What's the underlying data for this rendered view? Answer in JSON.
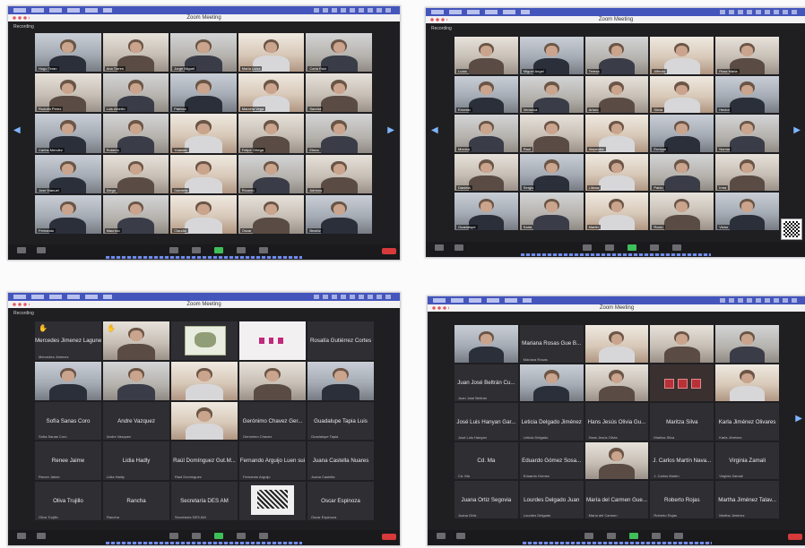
{
  "meeting_title": "Zoom Meeting",
  "sub_label": "Recording",
  "windows": [
    {
      "id": "w1",
      "tiles": [
        {
          "kind": "vid",
          "tone": "c",
          "name": "Hugo Teran"
        },
        {
          "kind": "vid",
          "tone": "b",
          "name": "Ana Torres"
        },
        {
          "kind": "vid",
          "tone": "a",
          "name": "Jorge Miguel"
        },
        {
          "kind": "vid",
          "tone": "d",
          "name": "Maria Luisa"
        },
        {
          "kind": "vid",
          "tone": "a",
          "name": "Carla Ruiz"
        },
        {
          "kind": "vid",
          "tone": "b",
          "name": "Rodolfo Perez"
        },
        {
          "kind": "vid",
          "tone": "a",
          "name": "Luis Alberto"
        },
        {
          "kind": "vid",
          "tone": "c",
          "name": "Patricia"
        },
        {
          "kind": "vid",
          "tone": "d",
          "name": "Marcela Vega"
        },
        {
          "kind": "vid",
          "tone": "b",
          "name": "Sandra"
        },
        {
          "kind": "vid",
          "tone": "c",
          "name": "Carlos Mendez"
        },
        {
          "kind": "vid",
          "tone": "a",
          "name": "Roberto"
        },
        {
          "kind": "vid",
          "tone": "d",
          "name": "Yolanda"
        },
        {
          "kind": "vid",
          "tone": "b",
          "name": "Felipe Ortega"
        },
        {
          "kind": "vid",
          "tone": "a",
          "name": "Elena"
        },
        {
          "kind": "vid",
          "tone": "c",
          "name": "Jose Manuel"
        },
        {
          "kind": "vid",
          "tone": "b",
          "name": "Diego"
        },
        {
          "kind": "vid",
          "tone": "d",
          "name": "Gabriela"
        },
        {
          "kind": "vid",
          "tone": "a",
          "name": "Ricardo"
        },
        {
          "kind": "vid",
          "tone": "b",
          "name": "Adriana"
        },
        {
          "kind": "vid",
          "tone": "c",
          "name": "Fernando"
        },
        {
          "kind": "vid",
          "tone": "a",
          "name": "Mauricio"
        },
        {
          "kind": "vid",
          "tone": "d",
          "name": "Claudia"
        },
        {
          "kind": "vid",
          "tone": "b",
          "name": "Oscar"
        },
        {
          "kind": "vid",
          "tone": "c",
          "name": "Beatriz"
        }
      ]
    },
    {
      "id": "w2",
      "tiles": [
        {
          "kind": "vid",
          "tone": "b",
          "name": "Lucia"
        },
        {
          "kind": "vid",
          "tone": "c",
          "name": "Miguel Angel"
        },
        {
          "kind": "vid",
          "tone": "a",
          "name": "Teresa"
        },
        {
          "kind": "vid",
          "tone": "d",
          "name": "Alfredo"
        },
        {
          "kind": "vid",
          "tone": "b",
          "name": "Rosa Maria"
        },
        {
          "kind": "vid",
          "tone": "c",
          "name": "Ernesto"
        },
        {
          "kind": "vid",
          "tone": "a",
          "name": "Veronica"
        },
        {
          "kind": "vid",
          "tone": "b",
          "name": "Arturo"
        },
        {
          "kind": "vid",
          "tone": "d",
          "name": "Silvia"
        },
        {
          "kind": "vid",
          "tone": "c",
          "name": "Hector"
        },
        {
          "kind": "vid",
          "tone": "a",
          "name": "Monica"
        },
        {
          "kind": "vid",
          "tone": "b",
          "name": "Raul"
        },
        {
          "kind": "vid",
          "tone": "d",
          "name": "Alejandra"
        },
        {
          "kind": "vid",
          "tone": "c",
          "name": "Enrique"
        },
        {
          "kind": "vid",
          "tone": "a",
          "name": "Norma"
        },
        {
          "kind": "vid",
          "tone": "b",
          "name": "Daniela"
        },
        {
          "kind": "vid",
          "tone": "c",
          "name": "Sergio"
        },
        {
          "kind": "vid",
          "tone": "d",
          "name": "Liliana"
        },
        {
          "kind": "vid",
          "tone": "a",
          "name": "Pablo"
        },
        {
          "kind": "vid",
          "tone": "b",
          "name": "Irma"
        },
        {
          "kind": "vid",
          "tone": "c",
          "name": "Guadalupe"
        },
        {
          "kind": "vid",
          "tone": "a",
          "name": "Karla"
        },
        {
          "kind": "vid",
          "tone": "d",
          "name": "Martin"
        },
        {
          "kind": "vid",
          "tone": "b",
          "name": "Rocio"
        },
        {
          "kind": "vid",
          "tone": "c",
          "name": "Victor"
        }
      ]
    },
    {
      "id": "w3",
      "tiles": [
        {
          "kind": "txt",
          "big": "Mercedes Jimenez Lagunes",
          "name": "Mercedes Jimenez",
          "hand": true
        },
        {
          "kind": "vid",
          "tone": "b",
          "name": "",
          "hand": true
        },
        {
          "kind": "logo",
          "name": ""
        },
        {
          "kind": "pink",
          "name": ""
        },
        {
          "kind": "txt",
          "big": "Rosalía Gutiérrez Cortes",
          "name": ""
        },
        {
          "kind": "vid",
          "tone": "c",
          "name": ""
        },
        {
          "kind": "vid",
          "tone": "a",
          "name": ""
        },
        {
          "kind": "vid",
          "tone": "d",
          "name": ""
        },
        {
          "kind": "vid",
          "tone": "b",
          "name": ""
        },
        {
          "kind": "vid",
          "tone": "c",
          "name": ""
        },
        {
          "kind": "txt",
          "big": "Sofía Sanas Coro",
          "name": "Sofía Sanas Coro"
        },
        {
          "kind": "txt",
          "big": "Andre Vazquez",
          "name": "Andre Vazquez"
        },
        {
          "kind": "vid",
          "tone": "d",
          "name": ""
        },
        {
          "kind": "txt",
          "big": "Gerónimo Chavez Ger...",
          "name": "Gerónimo Chavez"
        },
        {
          "kind": "txt",
          "big": "Guadalupe Tapia Luis",
          "name": "Guadalupe Tapia"
        },
        {
          "kind": "txt",
          "big": "Renee Jaime",
          "name": "Renee Jaime"
        },
        {
          "kind": "txt",
          "big": "Lidia Hadly",
          "name": "Lidia Hadly"
        },
        {
          "kind": "txt",
          "big": "Raúl Domínguez Gut.M...",
          "name": "Raúl Domínguez"
        },
        {
          "kind": "txt",
          "big": "Fernando Arguijo Luen sui",
          "name": "Fernando Arguijo"
        },
        {
          "kind": "txt",
          "big": "Juana Castella Nuares",
          "name": "Juana Castella"
        },
        {
          "kind": "txt",
          "big": "Oliva Trujillo",
          "name": "Oliva Trujillo"
        },
        {
          "kind": "txt",
          "big": "Rancha",
          "name": "Rancha"
        },
        {
          "kind": "txt",
          "big": "Secretaría DES AM",
          "name": "Secretaría DES AM"
        },
        {
          "kind": "bw",
          "name": ""
        },
        {
          "kind": "txt",
          "big": "Oscar Espinoza",
          "name": "Oscar Espinoza"
        }
      ]
    },
    {
      "id": "w4",
      "tiles": [
        {
          "kind": "vid",
          "tone": "c",
          "name": ""
        },
        {
          "kind": "txt",
          "big": "Mariana Rosas Gue B...",
          "name": "Mariana Rosas"
        },
        {
          "kind": "vid",
          "tone": "d",
          "name": ""
        },
        {
          "kind": "vid",
          "tone": "b",
          "name": ""
        },
        {
          "kind": "vid",
          "tone": "a",
          "name": ""
        },
        {
          "kind": "txt",
          "big": "Juan José Beltrán Cu...",
          "name": "Juan José Beltrán"
        },
        {
          "kind": "vid",
          "tone": "c",
          "name": ""
        },
        {
          "kind": "vid",
          "tone": "b",
          "name": ""
        },
        {
          "kind": "redclock",
          "name": ""
        },
        {
          "kind": "vid",
          "tone": "d",
          "name": ""
        },
        {
          "kind": "txt",
          "big": "José Luis Hanyan Gar...",
          "name": "José Luis Hanyan"
        },
        {
          "kind": "txt",
          "big": "Leticia Delgado Jiménez",
          "name": "Leticia Delgado"
        },
        {
          "kind": "txt",
          "big": "Hans Jesús Olivia Gu...",
          "name": "Hans Jesús Olivia"
        },
        {
          "kind": "txt",
          "big": "Maritza Silva",
          "name": "Maritza Silva"
        },
        {
          "kind": "txt",
          "big": "Karla Jiménez Olivares",
          "name": "Karla Jiménez"
        },
        {
          "kind": "txt",
          "big": "Cd. Ma",
          "name": "Cd. Ma"
        },
        {
          "kind": "txt",
          "big": "Eduardo Gómez Sosa...",
          "name": "Eduardo Gómez"
        },
        {
          "kind": "vid",
          "tone": "b",
          "name": ""
        },
        {
          "kind": "txt",
          "big": "J. Carlos Martín Nava...",
          "name": "J. Carlos Martín"
        },
        {
          "kind": "txt",
          "big": "Virginia Zamali",
          "name": "Virginia Zamali"
        },
        {
          "kind": "txt",
          "big": "Juana Ortiz Segovia",
          "name": "Juana Ortiz"
        },
        {
          "kind": "txt",
          "big": "Lourdes Delgado Juan",
          "name": "Lourdes Delgado"
        },
        {
          "kind": "txt",
          "big": "María del Carmen Gue...",
          "name": "María del Carmen"
        },
        {
          "kind": "txt",
          "big": "Roberto Rojas",
          "name": "Roberto Rojas"
        },
        {
          "kind": "txt",
          "big": "Martha Jiménez Talav...",
          "name": "Martha Jiménez"
        }
      ]
    }
  ]
}
